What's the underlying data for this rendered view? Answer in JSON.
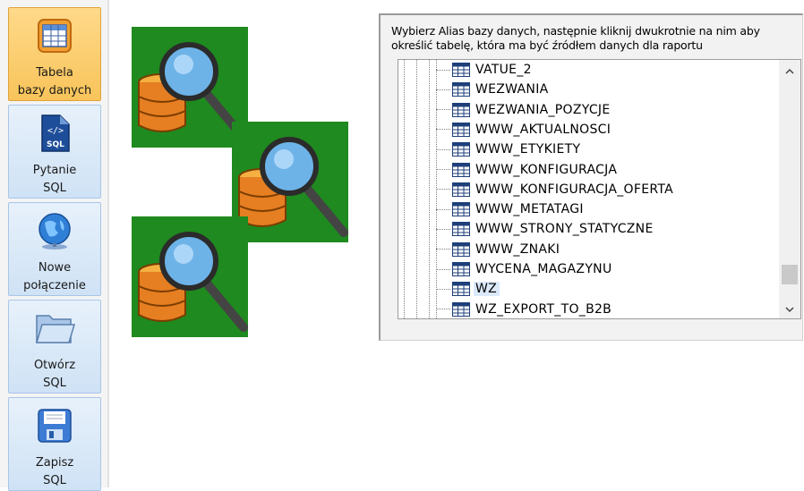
{
  "sidebar": {
    "items": [
      {
        "label": "Tabela\nbazy danych",
        "icon": "table-icon",
        "active": true
      },
      {
        "label": "Pytanie\nSQL",
        "icon": "sql-file-icon",
        "active": false
      },
      {
        "label": "Nowe\npołączenie",
        "icon": "globe-icon",
        "active": false
      },
      {
        "label": "Otwórz\nSQL",
        "icon": "folder-open-icon",
        "active": false
      },
      {
        "label": "Zapisz\nSQL",
        "icon": "save-disk-icon",
        "active": false
      }
    ]
  },
  "panel": {
    "instruction": "Wybierz Alias bazy danych, następnie kliknij dwukrotnie na nim aby określić tabelę,  która ma być źródłem danych dla raportu"
  },
  "tree": {
    "items": [
      {
        "name": "VATUE_2",
        "selected": false
      },
      {
        "name": "WEZWANIA",
        "selected": false
      },
      {
        "name": "WEZWANIA_POZYCJE",
        "selected": false
      },
      {
        "name": "WWW_AKTUALNOSCI",
        "selected": false
      },
      {
        "name": "WWW_ETYKIETY",
        "selected": false
      },
      {
        "name": "WWW_KONFIGURACJA",
        "selected": false
      },
      {
        "name": "WWW_KONFIGURACJA_OFERTA",
        "selected": false
      },
      {
        "name": "WWW_METATAGI",
        "selected": false
      },
      {
        "name": "WWW_STRONY_STATYCZNE",
        "selected": false
      },
      {
        "name": "WWW_ZNAKI",
        "selected": false
      },
      {
        "name": "WYCENA_MAGAZYNU",
        "selected": false
      },
      {
        "name": "WZ",
        "selected": true
      },
      {
        "name": "WZ_EXPORT_TO_B2B",
        "selected": false
      }
    ],
    "scroll_position": 0.9
  },
  "colors": {
    "active_tab": "#f8c45a",
    "tab": "#cfe2f5",
    "image_bg": "#1f8a1f",
    "selection": "#dbe9fb"
  }
}
